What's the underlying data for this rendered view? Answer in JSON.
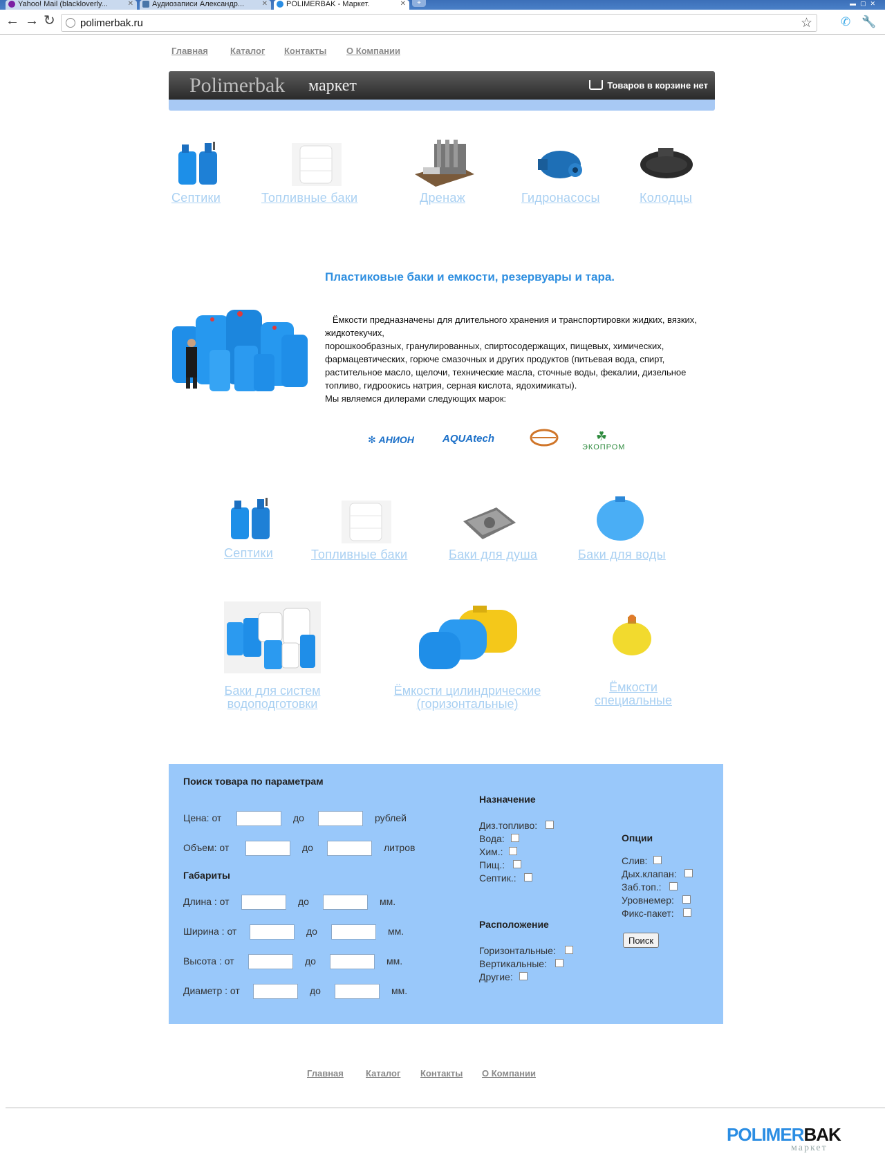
{
  "browser": {
    "tabs": [
      {
        "label": "Yahoo! Mail (blackloverly..."
      },
      {
        "label": "Аудиозаписи Александр..."
      },
      {
        "label": "POLIMERBAK - Маркет."
      }
    ],
    "url": "polimerbak.ru"
  },
  "nav": [
    "Главная",
    "Каталог",
    "Контакты",
    "О Компании"
  ],
  "header": {
    "brand": "Polimerbak",
    "brand_suffix": "маркет",
    "cart_text": "Товаров в корзине нет"
  },
  "top_categories": [
    "Септики",
    "Топливные баки",
    "Дренаж",
    "Гидронасосы",
    "Колодцы"
  ],
  "headline": "Пластиковые баки и емкости, резервуары и тара.",
  "description": [
    "   Ёмкости предназначены для длительного хранения и транспортировки жидких, вязких, жидкотекучих,",
    "порошкообразных, гранулированных, спиртосодержащих, пищевых, химических, фармацевтических, горюче смазочных и других продуктов (питьевая вода, спирт, растительное масло, щелочи, технические масла, сточные воды, фекалии, дизельное топливо, гидроокись натрия, серная кислота, ядохимикаты).",
    "Мы являемся дилерами следующих марок:"
  ],
  "dealers": [
    "АНИОН",
    "AQUAtech",
    "",
    "ЭКОПРОМ"
  ],
  "products_row1": [
    "Септики",
    "Топливные баки",
    "Баки для душа",
    "Баки для воды"
  ],
  "products_row2": [
    {
      "line1": "Баки для систем",
      "line2": "водоподготовки"
    },
    {
      "line1": "Ёмкости цилиндрические",
      "line2": "(горизонтальные)"
    },
    {
      "line1": "Ёмкости",
      "line2": "специальные"
    }
  ],
  "search": {
    "title": "Поиск товара по параметрам",
    "price": {
      "label": "Цена: от",
      "to": "до",
      "unit": "рублей"
    },
    "volume": {
      "label": "Объем: от",
      "to": "до",
      "unit": "литров"
    },
    "dimensions_title": "Габариты",
    "length": {
      "label": "Длина : от",
      "to": "до",
      "unit": "мм."
    },
    "width": {
      "label": "Ширина : от",
      "to": "до",
      "unit": "мм."
    },
    "height": {
      "label": "Высота : от",
      "to": "до",
      "unit": "мм."
    },
    "diameter": {
      "label": "Диаметр : от",
      "to": "до",
      "unit": "мм."
    },
    "purpose_title": "Назначение",
    "purpose": [
      "Диз.топливо:",
      "Вода:",
      "Хим.:",
      "Пищ.:",
      "Септик.:"
    ],
    "location_title": "Расположение",
    "location": [
      "Горизонтальные:",
      "Вертикальные:",
      "Другие:"
    ],
    "options_title": "Опции",
    "options": [
      "Слив:",
      "Дых.клапан:",
      "Заб.топ.:",
      "Уровнемер:",
      "Фикс-пакет:"
    ],
    "button": "Поиск"
  },
  "footer_nav": [
    "Главная",
    "Каталог",
    "Контакты",
    "О Компании"
  ],
  "footer_logo": {
    "part1": "POLIMER",
    "part2": "BAK",
    "sub": "маркет"
  },
  "colors": {
    "accent": "#2f8fe0",
    "link": "#a9d0f2",
    "panel": "#99c8fa",
    "header_bar": "#333333",
    "header_strip": "#a8c9f4"
  }
}
